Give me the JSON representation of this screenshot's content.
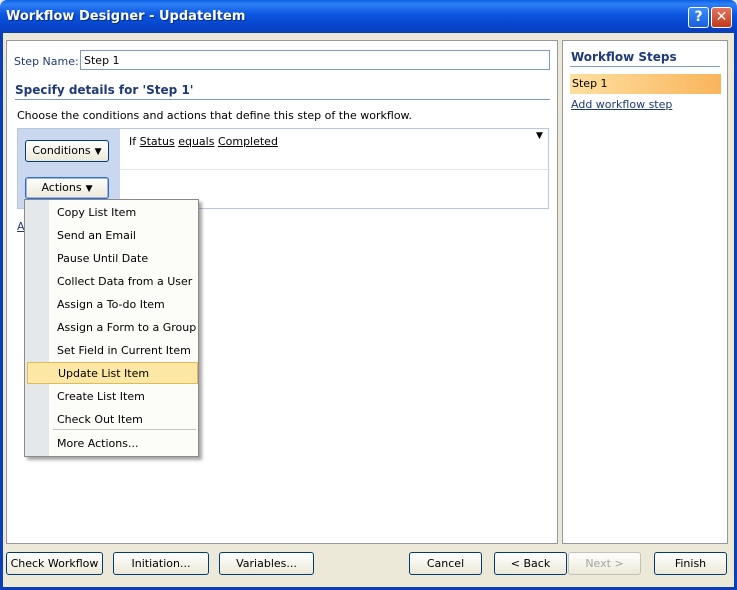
{
  "window": {
    "title": "Workflow Designer - UpdateItem",
    "help_symbol": "?",
    "close_symbol": "✕"
  },
  "step_name": {
    "label": "Step Name:",
    "value": "Step 1"
  },
  "details": {
    "heading": "Specify details for 'Step 1'",
    "instructions": "Choose the conditions and actions that define this step of the workflow.",
    "conditions_button": "Conditions",
    "actions_button": "Actions",
    "condition": {
      "prefix": "If",
      "field": "Status",
      "operator": "equals",
      "value": "Completed"
    },
    "stray_letter": "A"
  },
  "actions_menu": {
    "items": [
      "Copy List Item",
      "Send an Email",
      "Pause Until Date",
      "Collect Data from a User",
      "Assign a To-do Item",
      "Assign a Form to a Group",
      "Set Field in Current Item",
      "Update List Item",
      "Create List Item",
      "Check Out Item"
    ],
    "highlighted": "Update List Item",
    "more": "More Actions..."
  },
  "sidebar": {
    "title": "Workflow Steps",
    "steps": [
      "Step 1"
    ],
    "add_link": "Add workflow step"
  },
  "buttons": {
    "check_workflow": "Check Workflow",
    "initiation": "Initiation...",
    "variables": "Variables...",
    "cancel": "Cancel",
    "back": "< Back",
    "next": "Next >",
    "finish": "Finish"
  }
}
